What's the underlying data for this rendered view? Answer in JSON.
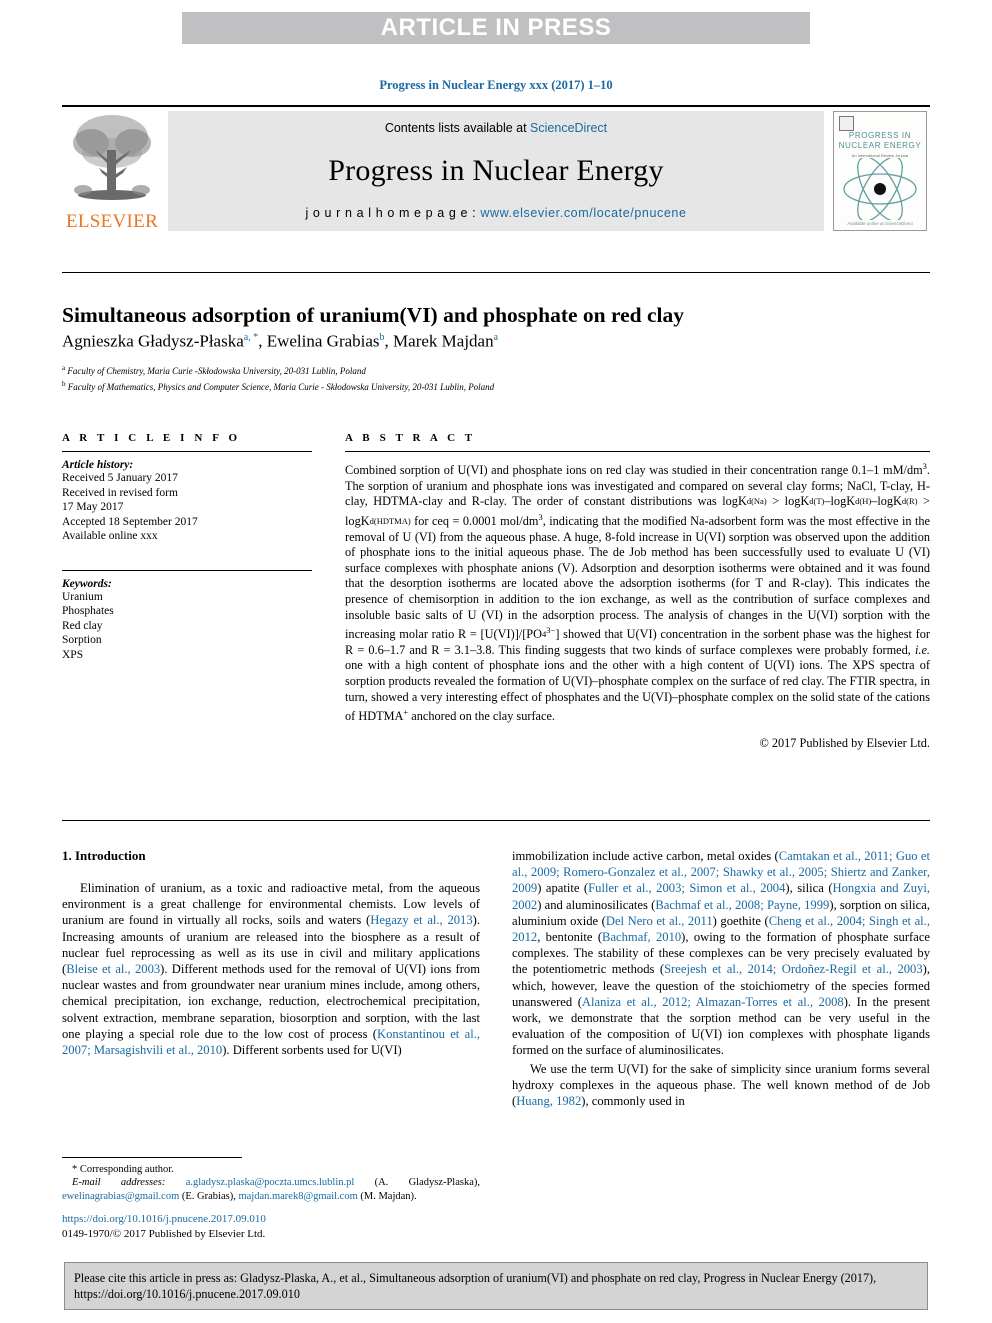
{
  "banner": {
    "text": "ARTICLE IN PRESS"
  },
  "journal_ref": "Progress in Nuclear Energy xxx (2017) 1–10",
  "masthead": {
    "publisher_name": "ELSEVIER",
    "contents_prefix": "Contents lists available at ",
    "contents_link": "ScienceDirect",
    "journal_title": "Progress in Nuclear Energy",
    "homepage_prefix": "j o u r n a l   h o m e p a g e :  ",
    "homepage_url": "www.elsevier.com/locate/pnucene",
    "cover": {
      "title_line1": "PROGRESS IN",
      "title_line2": "NUCLEAR ENERGY",
      "subtitle": "An International Review Journal",
      "footer": "Available online at ScienceDirect"
    },
    "accent_orange": "#e87722",
    "accent_blue": "#1a6aa2",
    "cover_teal": "#4f8f94"
  },
  "article": {
    "title": "Simultaneous adsorption of uranium(VI) and phosphate on red clay",
    "authors": [
      {
        "name": "Agnieszka Gładysz-Płaska",
        "marks": "a, *"
      },
      {
        "name": "Ewelina Grabias",
        "marks": "b"
      },
      {
        "name": "Marek Majdan",
        "marks": "a"
      }
    ],
    "affiliations": [
      {
        "mark": "a",
        "text": "Faculty of Chemistry, Maria Curie -Skłodowska University, 20-031 Lublin, Poland"
      },
      {
        "mark": "b",
        "text": "Faculty of Mathematics, Physics and Computer Science, Maria Curie - Skłodowska University, 20-031 Lublin, Poland"
      }
    ]
  },
  "article_info": {
    "heading": "A R T I C L E   I N F O",
    "history_label": "Article history:",
    "history": [
      "Received 5 January 2017",
      "Received in revised form",
      "17 May 2017",
      "Accepted 18 September 2017",
      "Available online xxx"
    ],
    "keywords_label": "Keywords:",
    "keywords": [
      "Uranium",
      "Phosphates",
      "Red clay",
      "Sorption",
      "XPS"
    ]
  },
  "abstract": {
    "heading": "A B S T R A C T",
    "copyright": "© 2017 Published by Elsevier Ltd."
  },
  "introduction": {
    "heading": "1.  Introduction"
  },
  "footnote": {
    "corresponding": "* Corresponding author.",
    "email_label": "E-mail addresses:",
    "emails": [
      {
        "address": "a.gladysz.plaska@poczta.umcs.lublin.pl",
        "owner": "(A. Gladysz-Plaska),"
      },
      {
        "address": "ewelinagrabias@gmail.com",
        "owner": "(E. Grabias),"
      },
      {
        "address": "majdan.marek8@gmail.com",
        "owner": "(M. Majdan)."
      }
    ]
  },
  "doi_block": {
    "doi_url": "https://doi.org/10.1016/j.pnucene.2017.09.010",
    "issn_line": "0149-1970/© 2017 Published by Elsevier Ltd."
  },
  "cite_box": {
    "text": "Please cite this article in press as: Gladysz-Plaska, A., et al., Simultaneous adsorption of uranium(VI) and phosphate on red clay, Progress in Nuclear Energy (2017), https://doi.org/10.1016/j.pnucene.2017.09.010"
  }
}
